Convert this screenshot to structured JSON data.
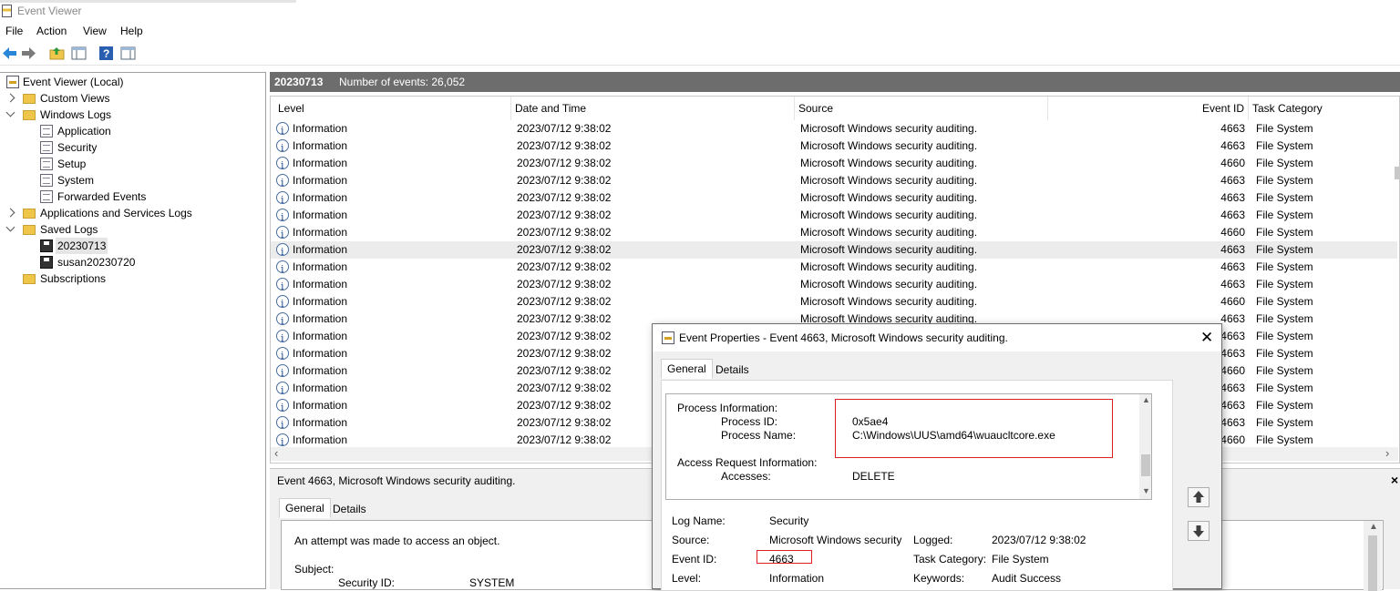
{
  "window": {
    "title": "Event Viewer"
  },
  "menu": [
    "File",
    "Action",
    "View",
    "Help"
  ],
  "toolbar": {
    "icons": [
      "back-arrow-icon",
      "forward-arrow-icon",
      "folder-up-icon",
      "show-hide-tree-icon",
      "help-icon",
      "properties-pane-icon"
    ]
  },
  "tree": {
    "root": "Event Viewer (Local)",
    "custom_views": "Custom Views",
    "windows_logs": "Windows Logs",
    "application": "Application",
    "security": "Security",
    "setup": "Setup",
    "system": "System",
    "forwarded": "Forwarded Events",
    "app_services": "Applications and Services Logs",
    "saved_logs": "Saved Logs",
    "saved1": "20230713",
    "saved2": "susan20230720",
    "subscriptions": "Subscriptions"
  },
  "main": {
    "log_name": "20230713",
    "event_count": "Number of events: 26,052",
    "columns": {
      "level": "Level",
      "date": "Date and Time",
      "source": "Source",
      "event_id": "Event ID",
      "task": "Task Category"
    },
    "rows": [
      {
        "level": "Information",
        "date": "2023/07/12 9:38:02",
        "source": "Microsoft Windows security auditing.",
        "event_id": "4663",
        "task": "File System"
      },
      {
        "level": "Information",
        "date": "2023/07/12 9:38:02",
        "source": "Microsoft Windows security auditing.",
        "event_id": "4663",
        "task": "File System"
      },
      {
        "level": "Information",
        "date": "2023/07/12 9:38:02",
        "source": "Microsoft Windows security auditing.",
        "event_id": "4660",
        "task": "File System"
      },
      {
        "level": "Information",
        "date": "2023/07/12 9:38:02",
        "source": "Microsoft Windows security auditing.",
        "event_id": "4663",
        "task": "File System"
      },
      {
        "level": "Information",
        "date": "2023/07/12 9:38:02",
        "source": "Microsoft Windows security auditing.",
        "event_id": "4663",
        "task": "File System"
      },
      {
        "level": "Information",
        "date": "2023/07/12 9:38:02",
        "source": "Microsoft Windows security auditing.",
        "event_id": "4663",
        "task": "File System"
      },
      {
        "level": "Information",
        "date": "2023/07/12 9:38:02",
        "source": "Microsoft Windows security auditing.",
        "event_id": "4660",
        "task": "File System"
      },
      {
        "level": "Information",
        "date": "2023/07/12 9:38:02",
        "source": "Microsoft Windows security auditing.",
        "event_id": "4663",
        "task": "File System"
      },
      {
        "level": "Information",
        "date": "2023/07/12 9:38:02",
        "source": "Microsoft Windows security auditing.",
        "event_id": "4663",
        "task": "File System"
      },
      {
        "level": "Information",
        "date": "2023/07/12 9:38:02",
        "source": "Microsoft Windows security auditing.",
        "event_id": "4663",
        "task": "File System"
      },
      {
        "level": "Information",
        "date": "2023/07/12 9:38:02",
        "source": "Microsoft Windows security auditing.",
        "event_id": "4660",
        "task": "File System"
      },
      {
        "level": "Information",
        "date": "2023/07/12 9:38:02",
        "source": "Microsoft Windows security auditing.",
        "event_id": "4663",
        "task": "File System"
      },
      {
        "level": "Information",
        "date": "2023/07/12 9:38:02",
        "source": "",
        "event_id": "4663",
        "task": "File System"
      },
      {
        "level": "Information",
        "date": "2023/07/12 9:38:02",
        "source": "",
        "event_id": "4663",
        "task": "File System"
      },
      {
        "level": "Information",
        "date": "2023/07/12 9:38:02",
        "source": "",
        "event_id": "4660",
        "task": "File System"
      },
      {
        "level": "Information",
        "date": "2023/07/12 9:38:02",
        "source": "",
        "event_id": "4663",
        "task": "File System"
      },
      {
        "level": "Information",
        "date": "2023/07/12 9:38:02",
        "source": "",
        "event_id": "4663",
        "task": "File System"
      },
      {
        "level": "Information",
        "date": "2023/07/12 9:38:02",
        "source": "",
        "event_id": "4663",
        "task": "File System"
      },
      {
        "level": "Information",
        "date": "2023/07/12 9:38:02",
        "source": "",
        "event_id": "4660",
        "task": "File System"
      }
    ],
    "selected_row": 7
  },
  "detail": {
    "title": "Event 4663, Microsoft Windows security auditing.",
    "tab_general": "General",
    "tab_details": "Details",
    "line1": "An attempt was made to access an object.",
    "subject": "Subject:",
    "security_id_label": "Security ID:",
    "security_id_value": "SYSTEM"
  },
  "dialog": {
    "title": "Event Properties - Event 4663, Microsoft Windows security auditing.",
    "tab_general": "General",
    "tab_details": "Details",
    "proc_info": "Process Information:",
    "proc_id_label": "Process ID:",
    "proc_id_value": "0x5ae4",
    "proc_name_label": "Process Name:",
    "proc_name_value": "C:\\Windows\\UUS\\amd64\\wuaucltcore.exe",
    "access_info": "Access Request Information:",
    "accesses_label": "Accesses:",
    "accesses_value": "DELETE",
    "log_name_label": "Log Name:",
    "log_name_value": "Security",
    "source_label": "Source:",
    "source_value": "Microsoft Windows security",
    "logged_label": "Logged:",
    "logged_value": "2023/07/12 9:38:02",
    "event_id_label": "Event ID:",
    "event_id_value": "4663",
    "task_label": "Task Category:",
    "task_value": "File System",
    "level_label": "Level:",
    "level_value": "Information",
    "keywords_label": "Keywords:",
    "keywords_value": "Audit Success",
    "highlight_color": "#e02020"
  }
}
